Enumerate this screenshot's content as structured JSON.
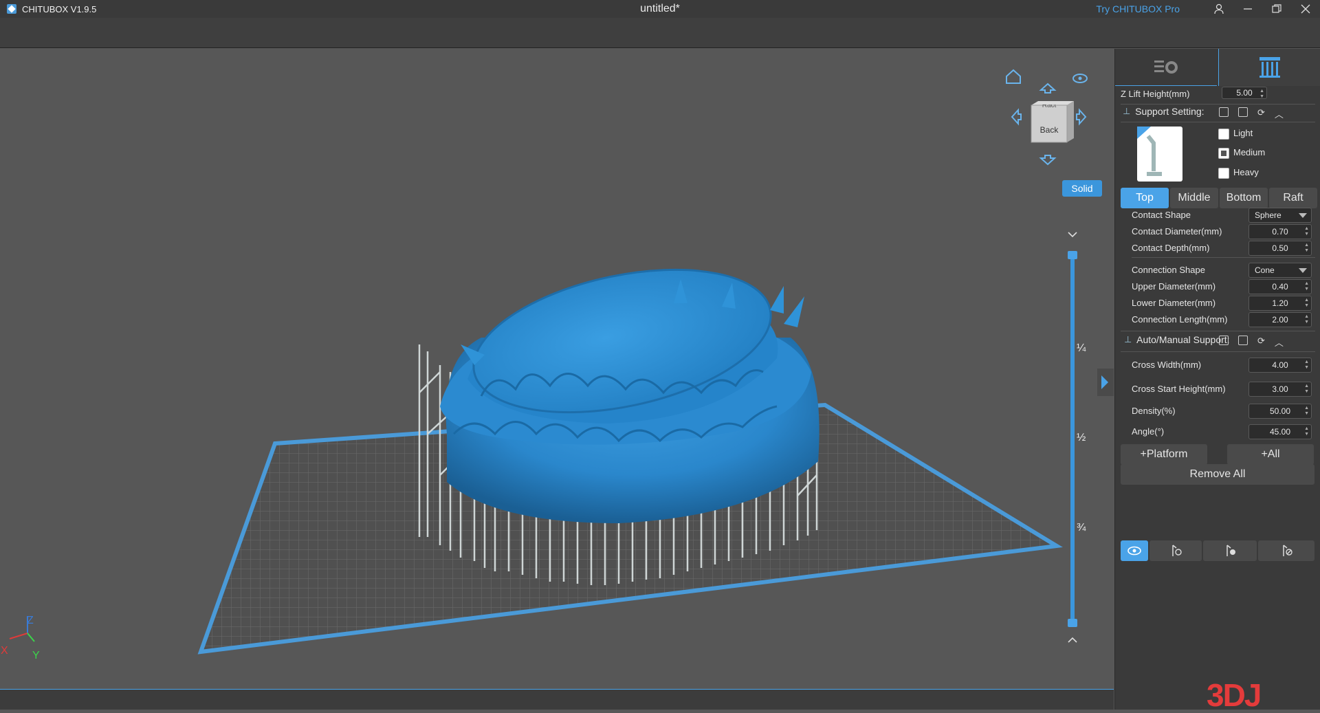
{
  "titlebar": {
    "app_title": "CHITUBOX V1.9.5",
    "doc_title": "untitled*",
    "try_pro": "Try CHITUBOX Pro"
  },
  "viewport": {
    "view_cube_face": "Back",
    "view_cube_top": "Ract",
    "render_mode": "Solid",
    "slider_marks": [
      "¼",
      "½",
      "¾"
    ],
    "axes": {
      "x": "X",
      "y": "Y",
      "z": "Z"
    }
  },
  "watermark": "3DJ",
  "panel": {
    "z_lift": {
      "label": "Z Lift Height(mm)",
      "value": "5.00"
    },
    "support_setting": {
      "title": "Support Setting:",
      "presets": [
        {
          "label": "Light",
          "checked": false
        },
        {
          "label": "Medium",
          "checked": true
        },
        {
          "label": "Heavy",
          "checked": false
        }
      ]
    },
    "tabs": [
      {
        "label": "Top",
        "active": true
      },
      {
        "label": "Middle",
        "active": false
      },
      {
        "label": "Bottom",
        "active": false
      },
      {
        "label": "Raft",
        "active": false
      }
    ],
    "contact": {
      "shape_label": "Contact Shape",
      "shape_value": "Sphere",
      "diameter_label": "Contact Diameter(mm)",
      "diameter_value": "0.70",
      "depth_label": "Contact Depth(mm)",
      "depth_value": "0.50"
    },
    "connection": {
      "shape_label": "Connection Shape",
      "shape_value": "Cone",
      "upper_label": "Upper Diameter(mm)",
      "upper_value": "0.40",
      "lower_label": "Lower Diameter(mm)",
      "lower_value": "1.20",
      "length_label": "Connection Length(mm)",
      "length_value": "2.00"
    },
    "auto_manual": {
      "title": "Auto/Manual Support:",
      "cross_width_label": "Cross Width(mm)",
      "cross_width_value": "4.00",
      "cross_start_label": "Cross Start Height(mm)",
      "cross_start_value": "3.00",
      "density_label": "Density(%)",
      "density_value": "50.00",
      "angle_label": "Angle(°)",
      "angle_value": "45.00"
    },
    "buttons": {
      "platform": "+Platform",
      "all": "+All",
      "remove_all": "Remove All"
    }
  }
}
